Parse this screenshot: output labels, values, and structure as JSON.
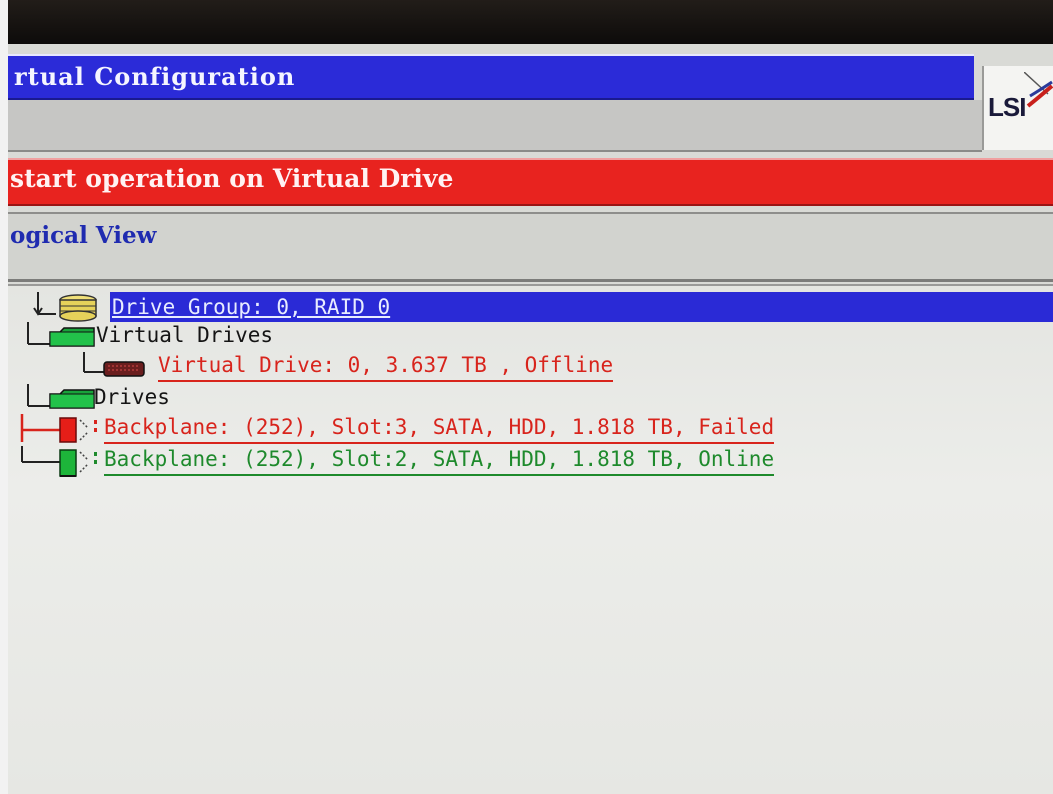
{
  "window": {
    "title": "rtual Configuration",
    "logo_text": "LSI"
  },
  "status": {
    "message": "start operation on Virtual Drive",
    "color": "#e8231f"
  },
  "view": {
    "label": "ogical View"
  },
  "tree": {
    "drive_group": "Drive Group: 0, RAID 0",
    "virtual_drives_label": "Virtual Drives",
    "virtual_drive": "Virtual Drive: 0, 3.637 TB , Offline",
    "drives_label": "Drives",
    "drive_failed": "Backplane: (252), Slot:3, SATA, HDD, 1.818 TB, Failed",
    "drive_online": "Backplane: (252), Slot:2, SATA, HDD, 1.818 TB, Online"
  },
  "colors": {
    "selection": "#2a2ad6",
    "failed": "#d8241c",
    "online": "#1e8a2c",
    "title_bar": "#2b2bd8"
  },
  "icons": {
    "drive_group": "disk-stack-icon",
    "virtual_drives": "folder-icon",
    "virtual_drive": "virtual-drive-icon",
    "drives": "folder-icon",
    "drive_failed": "failed-drive-icon",
    "drive_online": "online-drive-icon"
  }
}
